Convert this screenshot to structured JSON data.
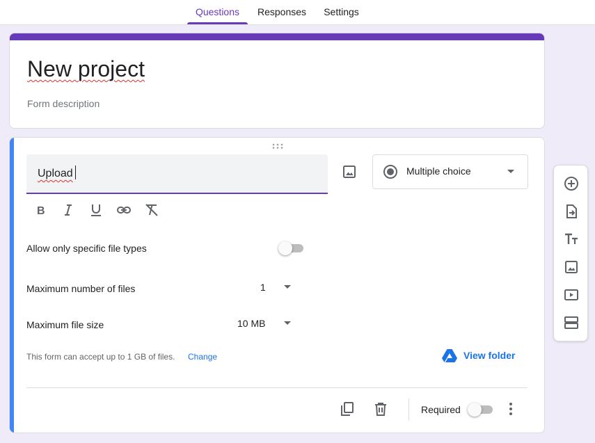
{
  "tabs": [
    {
      "label": "Questions",
      "active": true
    },
    {
      "label": "Responses",
      "active": false
    },
    {
      "label": "Settings",
      "active": false
    }
  ],
  "form": {
    "title": "New project",
    "description": "Form description"
  },
  "question": {
    "text": "Upload",
    "type_label": "Multiple choice",
    "allow_specific_types_label": "Allow only specific file types",
    "allow_specific_types_on": false,
    "max_files_label": "Maximum number of files",
    "max_files_value": "1",
    "max_size_label": "Maximum file size",
    "max_size_value": "10 MB",
    "note": "This form can accept up to 1 GB of files.",
    "change_link": "Change",
    "view_folder_label": "View folder",
    "required_label": "Required",
    "required_on": false
  },
  "icons": {
    "format": [
      "bold-icon",
      "italic-icon",
      "underline-icon",
      "link-icon",
      "clear-format-icon"
    ],
    "footer": [
      "duplicate-icon",
      "delete-icon",
      "more-vert-icon"
    ],
    "side": [
      "add-question-icon",
      "import-questions-icon",
      "add-title-icon",
      "add-image-icon",
      "add-video-icon",
      "add-section-icon"
    ]
  },
  "colors": {
    "accent": "#673ab7",
    "active_card": "#4285f4",
    "link": "#1a73e8",
    "background": "#f0ebf8"
  }
}
